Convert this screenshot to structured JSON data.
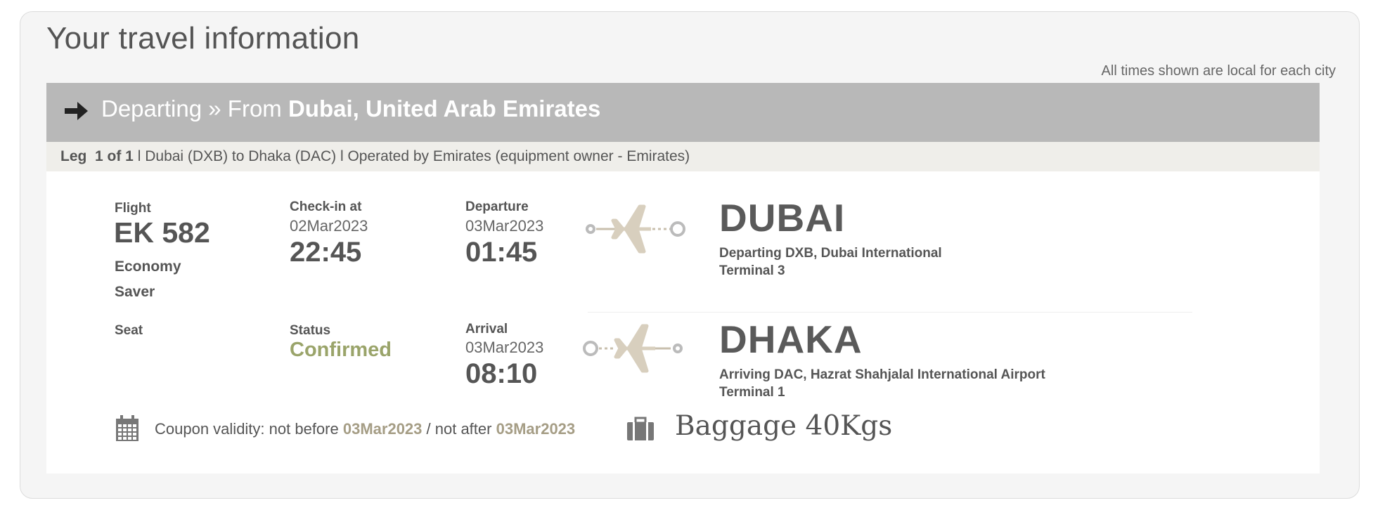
{
  "title": "Your travel information",
  "times_note": "All times shown are local for each city",
  "header": {
    "label": "Departing",
    "sep": "»",
    "from_word": "From",
    "from_place": "Dubai, United Arab Emirates",
    "icon": "arrow-right-icon"
  },
  "leg": {
    "leg_label": "Leg",
    "leg_count": "1 of 1",
    "details": "l Dubai  (DXB)  to Dhaka  (DAC) l Operated by Emirates (equipment owner - Emirates)"
  },
  "flight": {
    "flight_label": "Flight",
    "flight_number": "EK 582",
    "fare_line1": "Economy",
    "fare_line2": "Saver",
    "seat_label": "Seat",
    "checkin_label": "Check-in at",
    "checkin_date": "02Mar2023",
    "checkin_time": "22:45",
    "status_label": "Status",
    "status_value": "Confirmed",
    "status_color": "#9aa46a",
    "departure_label": "Departure",
    "departure_date": "03Mar2023",
    "departure_time": "01:45",
    "arrival_label": "Arrival",
    "arrival_date": "03Mar2023",
    "arrival_time": "08:10"
  },
  "origin": {
    "city": "DUBAI",
    "detail": "Departing DXB, Dubai International",
    "terminal": "Terminal 3",
    "icon": "plane-departing-icon"
  },
  "destination": {
    "city": "DHAKA",
    "detail": "Arriving DAC, Hazrat Shahjalal International Airport",
    "terminal": "Terminal 1",
    "icon": "plane-arriving-icon"
  },
  "coupon": {
    "prefix": "Coupon validity: not before",
    "not_before": "03Mar2023",
    "mid": "/  not after",
    "not_after": "03Mar2023",
    "highlight_color": "#a59d85",
    "icon": "calendar-icon"
  },
  "baggage": {
    "text": "Baggage 40Kgs",
    "icon": "suitcase-icon"
  }
}
